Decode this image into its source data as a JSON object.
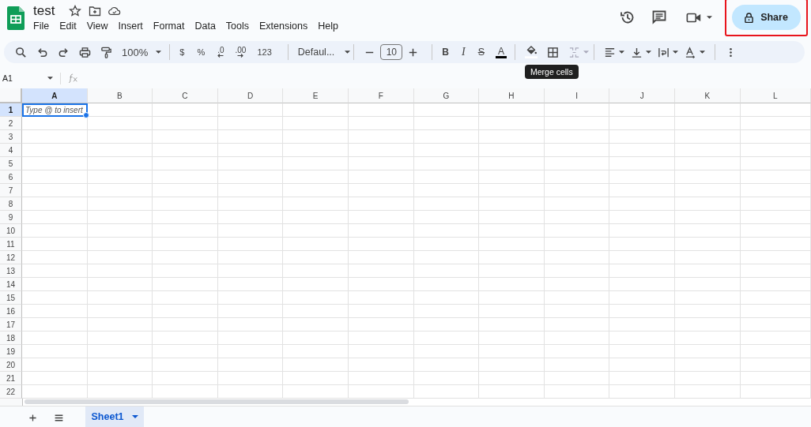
{
  "document": {
    "title": "test"
  },
  "menu": [
    "File",
    "Edit",
    "View",
    "Insert",
    "Format",
    "Data",
    "Tools",
    "Extensions",
    "Help"
  ],
  "share_button": {
    "label": "Share",
    "highlighted": true
  },
  "toolbar": {
    "zoom": "100%",
    "currency": "$",
    "percent": "%",
    "decrease_decimals": ".0",
    "increase_decimals": ".00",
    "number_format": "123",
    "font": "Defaul...",
    "font_size": "10",
    "bold": "B",
    "italic": "I",
    "strikethrough": "S",
    "text_color": "A"
  },
  "tooltip": "Merge cells",
  "formula_bar": {
    "name_box": "A1"
  },
  "grid": {
    "columns": [
      {
        "label": "A",
        "selected": true
      },
      {
        "label": "B",
        "selected": false
      },
      {
        "label": "C",
        "selected": false
      },
      {
        "label": "D",
        "selected": false
      },
      {
        "label": "E",
        "selected": false
      },
      {
        "label": "F",
        "selected": false
      },
      {
        "label": "G",
        "selected": false
      },
      {
        "label": "H",
        "selected": false
      },
      {
        "label": "I",
        "selected": false
      },
      {
        "label": "J",
        "selected": false
      },
      {
        "label": "K",
        "selected": false
      },
      {
        "label": "L",
        "selected": false
      }
    ],
    "rows": [
      {
        "label": "1",
        "selected": true
      },
      {
        "label": "2",
        "selected": false
      },
      {
        "label": "3",
        "selected": false
      },
      {
        "label": "4",
        "selected": false
      },
      {
        "label": "5",
        "selected": false
      },
      {
        "label": "6",
        "selected": false
      },
      {
        "label": "7",
        "selected": false
      },
      {
        "label": "8",
        "selected": false
      },
      {
        "label": "9",
        "selected": false
      },
      {
        "label": "10",
        "selected": false
      },
      {
        "label": "11",
        "selected": false
      },
      {
        "label": "12",
        "selected": false
      },
      {
        "label": "13",
        "selected": false
      },
      {
        "label": "14",
        "selected": false
      },
      {
        "label": "15",
        "selected": false
      },
      {
        "label": "16",
        "selected": false
      },
      {
        "label": "17",
        "selected": false
      },
      {
        "label": "18",
        "selected": false
      },
      {
        "label": "19",
        "selected": false
      },
      {
        "label": "20",
        "selected": false
      },
      {
        "label": "21",
        "selected": false
      },
      {
        "label": "22",
        "selected": false
      }
    ],
    "active_cell": {
      "placeholder": "Type @ to insert"
    }
  },
  "sheet_tabs": [
    {
      "label": "Sheet1",
      "selected": true
    }
  ]
}
